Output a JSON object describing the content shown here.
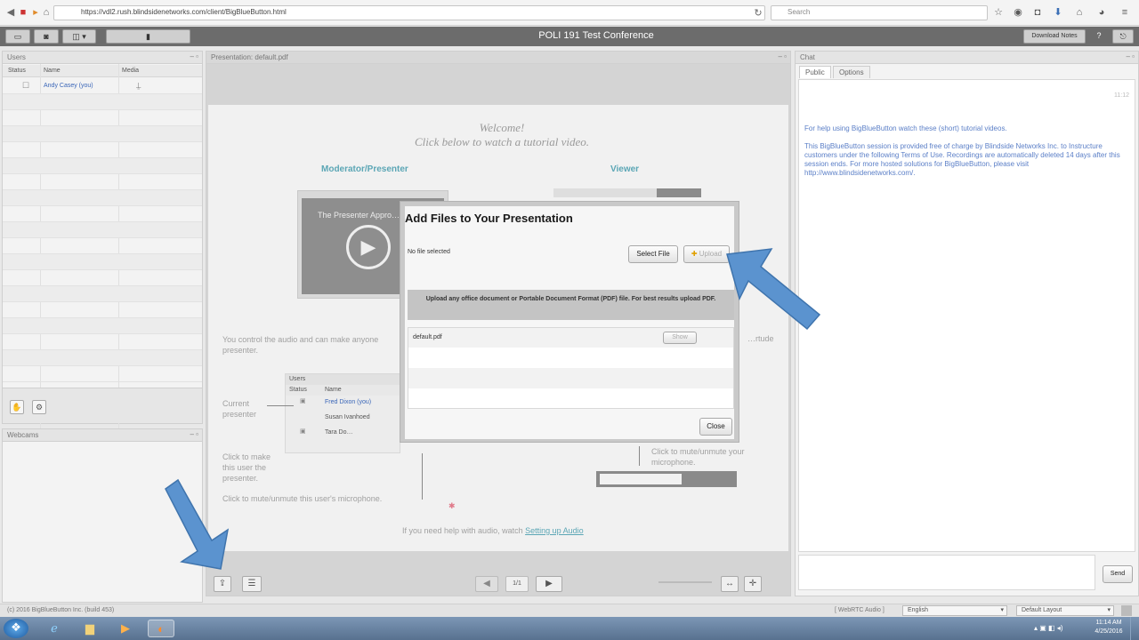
{
  "browser": {
    "url": "https://vdl2.rush.blindsidenetworks.com/client/BigBlueButton.html",
    "search_placeholder": "Search",
    "nav": [
      "back-icon",
      "stop-icon",
      "forward-icon",
      "home-icon"
    ],
    "toolbar_icons": [
      "star-icon",
      "camera-icon",
      "pocket-icon",
      "download-icon",
      "home-icon",
      "menu-icon"
    ]
  },
  "app": {
    "title": "POLI 191 Test Conference",
    "download_label": "Download Notes",
    "help_label": "?"
  },
  "users_panel": {
    "title": "Users",
    "columns": [
      "Status",
      "Name",
      "Media"
    ],
    "rows": [
      {
        "name": "Andy Casey (you)"
      }
    ]
  },
  "webcam_panel": {
    "title": "Webcams"
  },
  "presentation": {
    "title": "Presentation: default.pdf",
    "welcome": "Welcome!",
    "subtitle": "Click below to watch a tutorial video.",
    "col_left": "Moderator/Presenter",
    "col_right": "Viewer",
    "video_caption": "The Presenter Appro…",
    "control_text": "You control the audio and can make anyone presenter.",
    "right_fragment": "…rtude",
    "current_presenter": "Current presenter",
    "mini_users_title": "Users",
    "mini_status": "Status",
    "mini_name": "Name",
    "mini_names": [
      "Fred Dixon (you)",
      "Susan Ivanhoed",
      "Tara Do…"
    ],
    "click_make": "Click to make this user the presenter.",
    "click_mute": "Click to mute/unmute this user's microphone.",
    "click_mute_right": "Click to mute/unmute your microphone.",
    "audio_help_prefix": "If you need help with audio, watch",
    "audio_help_link": "Setting up Audio"
  },
  "modal": {
    "title": "Add Files to Your Presentation",
    "file_status": "No file selected",
    "select_file": "Select File",
    "upload": "Upload",
    "upload_hint": "Upload any office document or Portable Document Format (PDF) file.  For best results upload PDF.",
    "files": [
      {
        "name": "default.pdf",
        "action": "Show"
      }
    ],
    "close": "Close"
  },
  "chat": {
    "title": "Chat",
    "tabs": [
      "Public",
      "Options"
    ],
    "time": "11:12",
    "help_line": "For help using BigBlueButton watch these (short) tutorial videos.",
    "notice": "This BigBlueButton session is provided free of charge by Blindside Networks Inc. to Instructure customers under the following Terms of Use. Recordings are automatically deleted 14 days after this session ends. For more hosted solutions for BigBlueButton, please visit http://www.blindsidenetworks.com/.",
    "send": "Send"
  },
  "status_bar": {
    "copyright": "(c) 2016 BigBlueButton Inc. (build 453)",
    "webrtc": "[ WebRTC Audio ]",
    "language": "English",
    "layout": "Default Layout"
  },
  "taskbar": {
    "clock_time": "11:14 AM",
    "clock_date": "4/25/2016"
  },
  "colors": {
    "arrow": "#5b93cf",
    "accent_teal": "#5ba6b5",
    "link_blue": "#3a66b8"
  }
}
